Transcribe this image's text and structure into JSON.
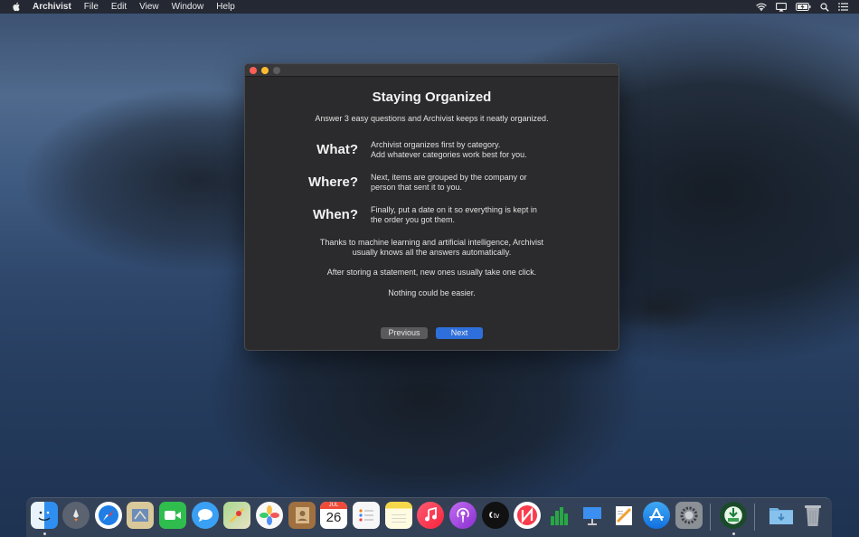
{
  "menubar": {
    "app_name": "Archivist",
    "items": [
      "File",
      "Edit",
      "View",
      "Window",
      "Help"
    ]
  },
  "window": {
    "title": "Staying Organized",
    "subtitle": "Answer 3 easy questions and Archivist keeps it neatly organized.",
    "questions": [
      {
        "q": "What?",
        "a": "Archivist organizes first by category.\nAdd whatever categories work best for you."
      },
      {
        "q": "Where?",
        "a": "Next, items are grouped by the company or\nperson that sent it to you."
      },
      {
        "q": "When?",
        "a": "Finally, put a date on it so everything is kept in\nthe order you got them."
      }
    ],
    "paragraphs": [
      "Thanks to machine learning and artificial intelligence, Archivist\nusually knows all the answers automatically.",
      "After storing a statement, new ones usually take one click.",
      "Nothing could be easier."
    ],
    "buttons": {
      "previous": "Previous",
      "next": "Next"
    }
  },
  "dock": {
    "calendar_month": "JUL",
    "calendar_day": "26",
    "apps": [
      {
        "name": "finder-icon",
        "color": "#2f8ff0"
      },
      {
        "name": "launchpad-icon",
        "color": "#6b7280"
      },
      {
        "name": "safari-icon",
        "color": "#1e7ee6"
      },
      {
        "name": "mail-icon",
        "color": "#8aa4c8"
      },
      {
        "name": "facetime-icon",
        "color": "#2fbe4d"
      },
      {
        "name": "messages-icon",
        "color": "#3aa0f5"
      },
      {
        "name": "maps-icon",
        "color": "#7cc26a"
      },
      {
        "name": "photos-icon",
        "color": "#f4f4f4"
      },
      {
        "name": "contacts-icon",
        "color": "#a07040"
      },
      {
        "name": "calendar-icon",
        "color": "#ffffff"
      },
      {
        "name": "reminders-icon",
        "color": "#f7f7f7"
      },
      {
        "name": "notes-icon",
        "color": "#f5d84a"
      },
      {
        "name": "music-icon",
        "color": "#fb3a5a"
      },
      {
        "name": "podcasts-icon",
        "color": "#9b3fe0"
      },
      {
        "name": "tv-icon",
        "color": "#111111"
      },
      {
        "name": "news-icon",
        "color": "#fa3c4c"
      },
      {
        "name": "numbers-icon",
        "color": "#f4f4f4"
      },
      {
        "name": "keynote-icon",
        "color": "#3b8ff0"
      },
      {
        "name": "pages-icon",
        "color": "#f0a030"
      },
      {
        "name": "app-store-icon",
        "color": "#1d8bf2"
      },
      {
        "name": "system-preferences-icon",
        "color": "#8b8f96"
      },
      {
        "name": "archivist-icon",
        "color": "#1a4a2a"
      },
      {
        "name": "downloads-folder-icon",
        "color": "#6fb0e0"
      },
      {
        "name": "trash-icon",
        "color": "#a8adb5"
      }
    ]
  }
}
